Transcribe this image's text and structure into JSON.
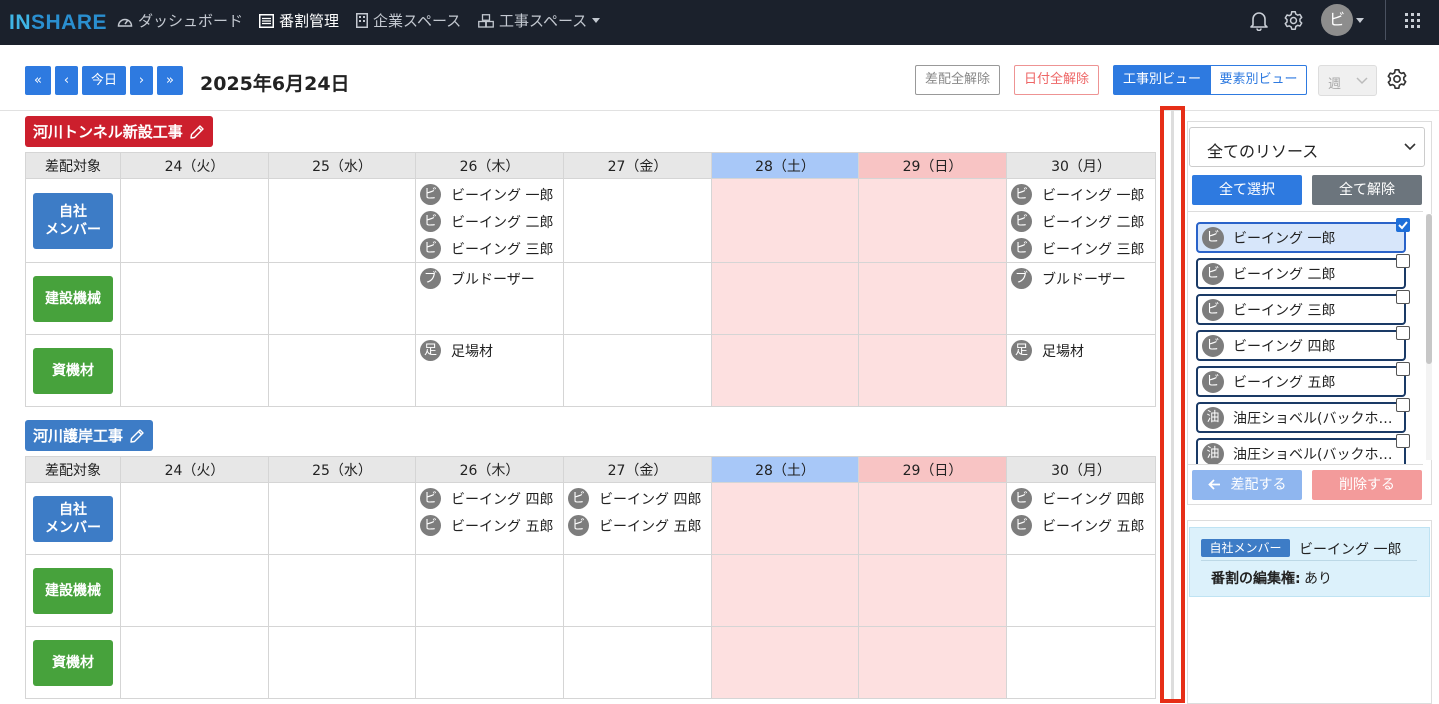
{
  "app": {
    "logo": "INSHARE",
    "user_initial": "ビ"
  },
  "nav": {
    "dashboard": "ダッシュボード",
    "schedule": "番割管理",
    "company_space": "企業スペース",
    "construction_space": "工事スペース"
  },
  "toolbar": {
    "first": "«",
    "prev": "‹",
    "today": "今日",
    "next": "›",
    "last": "»",
    "date": "2025年6月24日",
    "clear_assign": "差配全解除",
    "clear_date": "日付全解除",
    "view_project": "工事別ビュー",
    "view_element": "要素別ビュー",
    "range": "週"
  },
  "days": [
    "24（火）",
    "25（水）",
    "26（木）",
    "27（金）",
    "28（土）",
    "29（日）",
    "30（月）"
  ],
  "column_header": "差配対象",
  "projects": [
    {
      "name": "河川トンネル新設工事",
      "color": "#cc1f2d",
      "rows": [
        {
          "label": "自社\nメンバー",
          "kind": "blue",
          "cells": [
            [],
            [],
            [
              [
                "ビ",
                "ビーイング 一郎"
              ],
              [
                "ビ",
                "ビーイング 二郎"
              ],
              [
                "ビ",
                "ビーイング 三郎"
              ]
            ],
            [],
            [],
            [],
            [
              [
                "ビ",
                "ビーイング 一郎"
              ],
              [
                "ビ",
                "ビーイング 二郎"
              ],
              [
                "ビ",
                "ビーイング 三郎"
              ]
            ]
          ]
        },
        {
          "label": "建設機械",
          "kind": "green",
          "cells": [
            [],
            [],
            [
              [
                "ブ",
                "ブルドーザー"
              ]
            ],
            [],
            [],
            [],
            [
              [
                "ブ",
                "ブルドーザー"
              ]
            ]
          ]
        },
        {
          "label": "資機材",
          "kind": "green",
          "cells": [
            [],
            [],
            [
              [
                "足",
                "足場材"
              ]
            ],
            [],
            [],
            [],
            [
              [
                "足",
                "足場材"
              ]
            ]
          ]
        }
      ]
    },
    {
      "name": "河川護岸工事",
      "color": "#3d7cc6",
      "rows": [
        {
          "label": "自社\nメンバー",
          "kind": "blue",
          "cells": [
            [],
            [],
            [
              [
                "ビ",
                "ビーイング 四郎"
              ],
              [
                "ビ",
                "ビーイング 五郎"
              ]
            ],
            [
              [
                "ビ",
                "ビーイング 四郎"
              ],
              [
                "ビ",
                "ビーイング 五郎"
              ]
            ],
            [],
            [],
            [
              [
                "ビ",
                "ビーイング 四郎"
              ],
              [
                "ビ",
                "ビーイング 五郎"
              ]
            ]
          ]
        },
        {
          "label": "建設機械",
          "kind": "green",
          "cells": [
            [],
            [],
            [],
            [],
            [],
            [],
            []
          ]
        },
        {
          "label": "資機材",
          "kind": "green",
          "cells": [
            [],
            [],
            [],
            [],
            [],
            [],
            []
          ]
        }
      ]
    }
  ],
  "resource_panel": {
    "filter": "全てのリソース",
    "select_all": "全て選択",
    "clear_all": "全て解除",
    "assign": "差配する",
    "delete": "削除する",
    "items": [
      {
        "initial": "ビ",
        "name": "ビーイング 一郎",
        "checked": true
      },
      {
        "initial": "ビ",
        "name": "ビーイング 二郎",
        "checked": false
      },
      {
        "initial": "ビ",
        "name": "ビーイング 三郎",
        "checked": false
      },
      {
        "initial": "ビ",
        "name": "ビーイング 四郎",
        "checked": false
      },
      {
        "initial": "ビ",
        "name": "ビーイング 五郎",
        "checked": false
      },
      {
        "initial": "油",
        "name": "油圧ショベル(バックホー…",
        "checked": false
      },
      {
        "initial": "油",
        "name": "油圧ショベル(バックホー…",
        "checked": false
      }
    ]
  },
  "detail": {
    "category": "自社メンバー",
    "name": "ビーイング 一郎",
    "permission_label": "番割の編集権:",
    "permission_value": "あり"
  }
}
